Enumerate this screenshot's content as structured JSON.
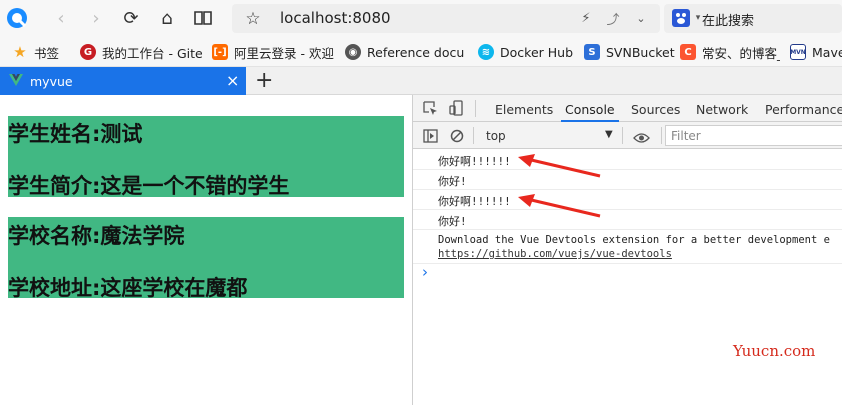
{
  "browser": {
    "address": "localhost:8080",
    "search_text": "在此搜索",
    "bookmarks": [
      {
        "label": "书签",
        "icon": "star-icon"
      },
      {
        "label": "我的工作台 - Gite",
        "icon": "gitee-icon"
      },
      {
        "label": "阿里云登录 - 欢迎",
        "icon": "aliyun-icon"
      },
      {
        "label": "Reference docun",
        "icon": "globe-icon"
      },
      {
        "label": "Docker Hub",
        "icon": "docker-icon"
      },
      {
        "label": "SVNBucket",
        "icon": "svn-icon"
      },
      {
        "label": "常安、的博客_",
        "icon": "csdn-icon"
      },
      {
        "label": "Mave",
        "icon": "maven-icon"
      }
    ],
    "tab": {
      "title": "myvue",
      "close": "×"
    },
    "new_tab": "+"
  },
  "page": {
    "student_name": "学生姓名:测试",
    "student_intro": "学生简介:这是一个不错的学生",
    "school_name": "学校名称:魔法学院",
    "school_address": "学校地址:这座学校在魔都"
  },
  "devtools": {
    "tabs": [
      "Elements",
      "Console",
      "Sources",
      "Network",
      "Performance"
    ],
    "active_tab": "Console",
    "context": "top",
    "filter_placeholder": "Filter",
    "logs": [
      "你好啊!!!!!!",
      "你好!",
      "你好啊!!!!!!",
      "你好!",
      "Download the Vue Devtools extension for a better development e"
    ],
    "link": "https://github.com/vuejs/vue-devtools",
    "prompt": "›"
  },
  "watermark": "Yuucn.com",
  "colors": {
    "accent": "#1a73e8",
    "vue_green": "#41b883",
    "arrow_red": "#e8281e"
  }
}
